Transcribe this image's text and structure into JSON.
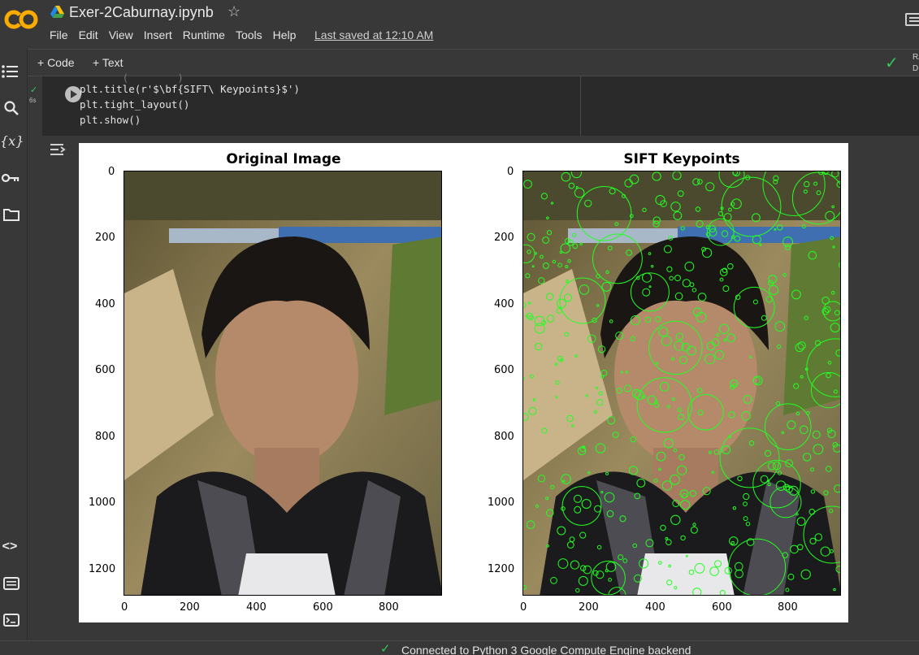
{
  "header": {
    "logo": "CO",
    "title": "Exer-2Caburnay.ipynb",
    "menu": [
      "File",
      "Edit",
      "View",
      "Insert",
      "Runtime",
      "Tools",
      "Help"
    ],
    "last_saved": "Last saved at 12:10 AM"
  },
  "toolbar": {
    "add_code": "+ Code",
    "add_text": "+ Text",
    "ram_label_1": "RA",
    "ram_label_2": "D"
  },
  "sidebar": {
    "icons": [
      "toc-icon",
      "search-icon",
      "variables-icon",
      "key-icon",
      "folder-icon",
      "code-snippets-icon",
      "command-palette-icon",
      "terminal-icon"
    ]
  },
  "cell": {
    "status_time": "6s",
    "code_lines": [
      "plt.title(r'$\\bf{SIFT\\ Keypoints}$')",
      "plt.tight_layout()",
      "plt.show()"
    ]
  },
  "figure": {
    "left_title": "Original Image",
    "right_title": "SIFT Keypoints",
    "y_ticks": [
      "0",
      "200",
      "400",
      "600",
      "800",
      "1000",
      "1200"
    ],
    "x_ticks": [
      "0",
      "200",
      "400",
      "600",
      "800"
    ]
  },
  "status": {
    "text": "Connected to Python 3 Google Compute Engine backend"
  },
  "colors": {
    "background": "#383838",
    "code_bg": "#2a2a2a",
    "accent_orange": "#f9ab00",
    "success_green": "#34c759",
    "keypoint_green": "#22ff22"
  }
}
